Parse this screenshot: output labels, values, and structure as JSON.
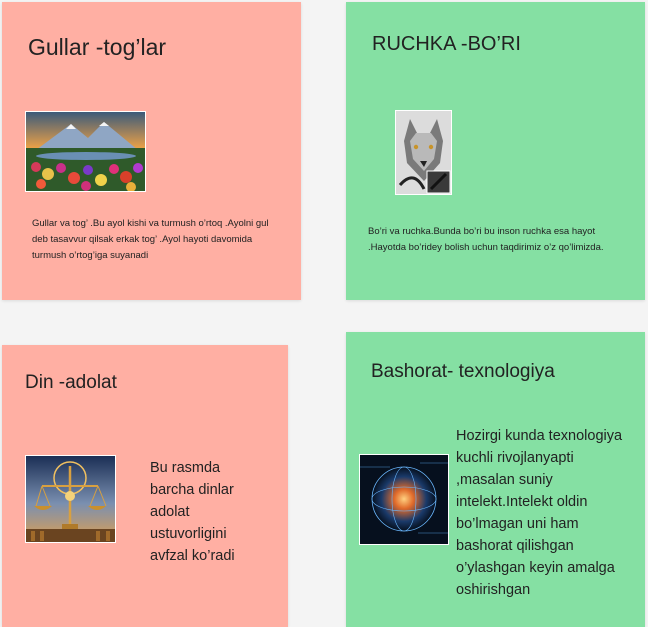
{
  "cards": [
    {
      "title": "Gullar -tog’lar",
      "image": "mountain-flowers-image",
      "text": "Gullar va tog’ .Bu ayol kishi va turmush o’rtoq .Ayolni gul deb tasavvur qilsak erkak tog’ .Ayol hayoti davomida turmush o’rtog’iga suyanadi",
      "color": "#ffafa3"
    },
    {
      "title": "RUCHKA -BO’RI",
      "image": "wolf-pen-image",
      "text": "Bo’ri va ruchka.Bunda bo’ri bu inson ruchka esa hayot .Hayotda bo’ridey bolish uchun taqdirimiz o’z qo’limizda.",
      "color": "#85e0a3"
    },
    {
      "title": "Din -adolat",
      "image": "justice-scales-image",
      "text": "Bu rasmda barcha dinlar adolat ustuvorligini avfzal ko’radi",
      "color": "#ffafa3"
    },
    {
      "title": "Bashorat- texnologiya",
      "image": "technology-globe-image",
      "text": "Hozirgi kunda texnologiya kuchli rivojlanyapti ,masalan suniy intelekt.Intelekt oldin bo’lmagan uni ham bashorat qilishgan o’ylashgan keyin amalga oshirishgan",
      "color": "#85e0a3"
    }
  ]
}
